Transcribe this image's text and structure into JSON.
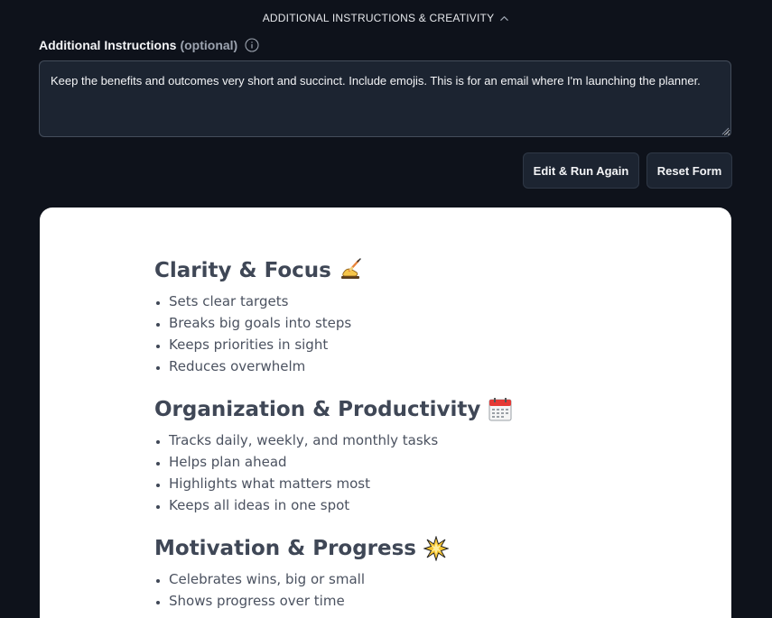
{
  "section_toggle": {
    "label": "ADDITIONAL INSTRUCTIONS & CREATIVITY",
    "icon": "chevron-up-icon"
  },
  "instructions_field": {
    "label": "Additional Instructions",
    "optional_label": "(optional)",
    "info_icon": "info-icon",
    "value": "Keep the benefits and outcomes very short and succinct. Include emojis. This is for an email where I'm launching the planner."
  },
  "buttons": {
    "edit_run": "Edit & Run Again",
    "reset": "Reset Form"
  },
  "result": {
    "sections": [
      {
        "title": "Clarity & Focus",
        "emoji": "writing-hand-icon",
        "items": [
          "Sets clear targets",
          "Breaks big goals into steps",
          "Keeps priorities in sight",
          "Reduces overwhelm"
        ]
      },
      {
        "title": "Organization & Productivity",
        "emoji": "calendar-icon",
        "items": [
          "Tracks daily, weekly, and monthly tasks",
          "Helps plan ahead",
          "Highlights what matters most",
          "Keeps all ideas in one spot"
        ]
      },
      {
        "title": "Motivation & Progress",
        "emoji": "sparkle-burst-icon",
        "items": [
          "Celebrates wins, big or small",
          "Shows progress over time"
        ]
      }
    ]
  },
  "colors": {
    "background": "#0e121b",
    "input_bg": "#1c2431",
    "card_bg": "#ffffff",
    "heading": "#3f4756"
  }
}
